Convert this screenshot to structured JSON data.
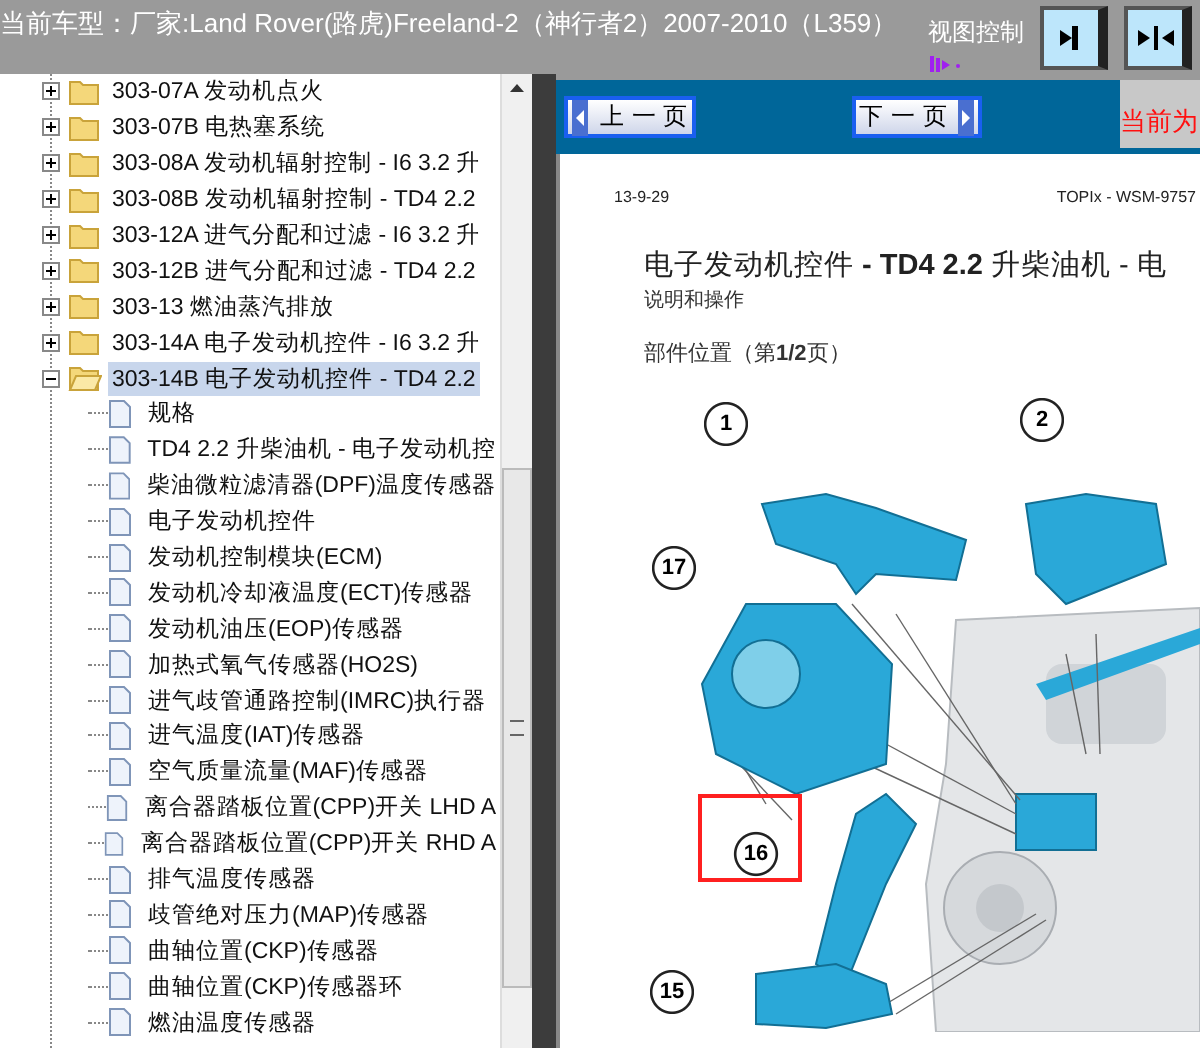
{
  "header": {
    "title": "当前车型：厂家:Land Rover(路虎)Freeland-2（神行者2）2007-2010（L359）",
    "view_control": "视图控制"
  },
  "tree": {
    "items": [
      {
        "label": "303-07A 发动机点火",
        "expanded": false,
        "selected": false
      },
      {
        "label": "303-07B 电热塞系统",
        "expanded": false,
        "selected": false
      },
      {
        "label": "303-08A 发动机辐射控制 - I6 3.2 升",
        "expanded": false,
        "selected": false
      },
      {
        "label": "303-08B 发动机辐射控制 - TD4 2.2",
        "expanded": false,
        "selected": false
      },
      {
        "label": "303-12A 进气分配和过滤 - I6 3.2 升",
        "expanded": false,
        "selected": false
      },
      {
        "label": "303-12B 进气分配和过滤 - TD4 2.2",
        "expanded": false,
        "selected": false
      },
      {
        "label": "303-13 燃油蒸汽排放",
        "expanded": false,
        "selected": false
      },
      {
        "label": "303-14A 电子发动机控件 - I6 3.2 升",
        "expanded": false,
        "selected": false
      },
      {
        "label": "303-14B 电子发动机控件 - TD4 2.2",
        "expanded": true,
        "selected": true,
        "children": [
          {
            "label": "规格",
            "selected": false
          },
          {
            "label": "TD4 2.2 升柴油机 - 电子发动机控",
            "selected": false
          },
          {
            "label": "柴油微粒滤清器(DPF)温度传感器",
            "selected": false
          },
          {
            "label": "电子发动机控件",
            "selected": false
          },
          {
            "label": "发动机控制模块(ECM)",
            "selected": false
          },
          {
            "label": "发动机冷却液温度(ECT)传感器",
            "selected": false
          },
          {
            "label": "发动机油压(EOP)传感器",
            "selected": false
          },
          {
            "label": "加热式氧气传感器(HO2S)",
            "selected": false
          },
          {
            "label": "进气歧管通路控制(IMRC)执行器",
            "selected": false
          },
          {
            "label": "进气温度(IAT)传感器",
            "selected": false
          },
          {
            "label": "空气质量流量(MAF)传感器",
            "selected": false
          },
          {
            "label": "离合器踏板位置(CPP)开关 LHD A",
            "selected": false
          },
          {
            "label": "离合器踏板位置(CPP)开关 RHD A",
            "selected": false
          },
          {
            "label": "排气温度传感器",
            "selected": false
          },
          {
            "label": "歧管绝对压力(MAP)传感器",
            "selected": false
          },
          {
            "label": "曲轴位置(CKP)传感器",
            "selected": false
          },
          {
            "label": "曲轴位置(CKP)传感器环",
            "selected": false
          },
          {
            "label": "燃油温度传感器",
            "selected": false
          }
        ]
      }
    ]
  },
  "toolbar": {
    "prev": "上 一 页",
    "next": "下 一 页",
    "current": "当前为"
  },
  "document": {
    "date": "13-9-29",
    "reference": "TOPIx - WSM-9757",
    "title": "电子发动机控件 **- TD4 2.2** 升柴油机 - 电",
    "subtitle": "说明和操作",
    "section": "部件位置（第**1/2**页）",
    "callouts": [
      {
        "label": "1",
        "highlighted": false
      },
      {
        "label": "2",
        "highlighted": false
      },
      {
        "label": "17",
        "highlighted": false
      },
      {
        "label": "16",
        "highlighted": true
      },
      {
        "label": "15",
        "highlighted": false
      }
    ]
  }
}
